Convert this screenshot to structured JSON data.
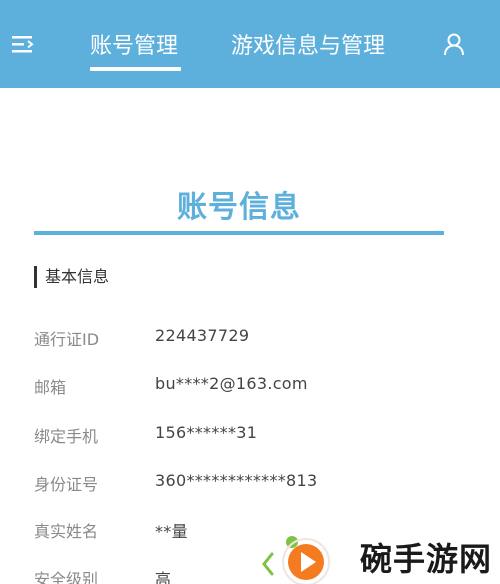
{
  "header": {
    "tabs": [
      {
        "label": "账号管理",
        "active": true
      },
      {
        "label": "游戏信息与管理",
        "active": false
      }
    ],
    "background_color": "#5eb0dc",
    "left_icon": "menu-icon",
    "right_icon": "user-icon"
  },
  "main": {
    "title": "账号信息",
    "accent_color": "#5eb0dc",
    "section_label": "基本信息",
    "rows": [
      {
        "label": "通行证ID",
        "value": "224437729"
      },
      {
        "label": "邮箱",
        "value": "bu****2@163.com"
      },
      {
        "label": "绑定手机",
        "value": "156******31"
      },
      {
        "label": "身份证号",
        "value": "360************813"
      },
      {
        "label": "真实姓名",
        "value": "**量"
      },
      {
        "label": "安全级别",
        "value": "高"
      }
    ]
  },
  "watermark": {
    "text": "碗手游网",
    "logo_icon": "play-logo-icon",
    "logo_colors": [
      "#7dc242",
      "#f47b20"
    ]
  }
}
